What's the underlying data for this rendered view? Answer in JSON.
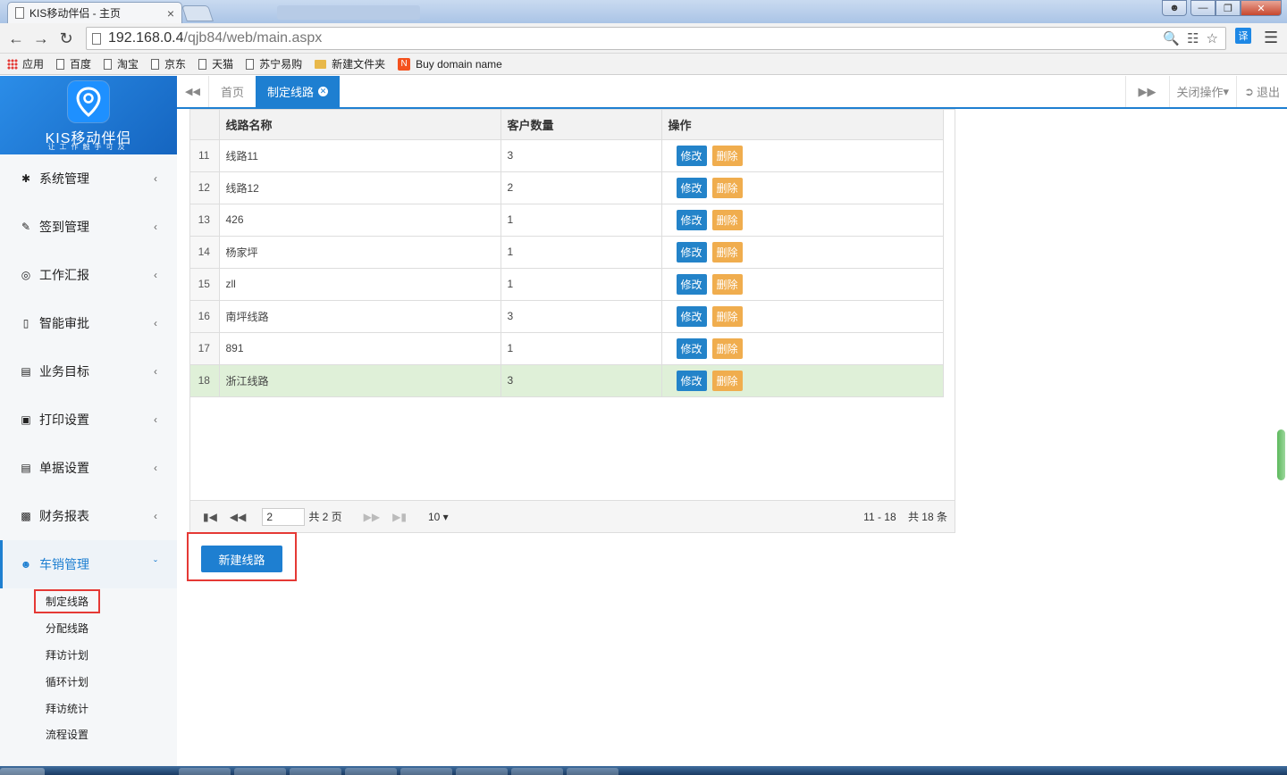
{
  "browser": {
    "tab_title": "KIS移动伴侣 - 主页",
    "tab_close": "×",
    "url_host": "192.168.0.4",
    "url_path": "/qjb84/web/main.aspx",
    "ext_label": "译",
    "bookmarks": [
      "应用",
      "百度",
      "淘宝",
      "京东",
      "天猫",
      "苏宁易购",
      "新建文件夹",
      "Buy domain name"
    ]
  },
  "brand": {
    "name": "KIS移动伴侣",
    "slogan": "让工作触手可及"
  },
  "sidebar": {
    "items": [
      {
        "label": "系统管理",
        "icon": "gear-icon"
      },
      {
        "label": "签到管理",
        "icon": "edit-icon"
      },
      {
        "label": "工作汇报",
        "icon": "target-icon"
      },
      {
        "label": "智能审批",
        "icon": "bookmark-icon"
      },
      {
        "label": "业务目标",
        "icon": "calendar-icon"
      },
      {
        "label": "打印设置",
        "icon": "monitor-icon"
      },
      {
        "label": "单据设置",
        "icon": "calendar-icon"
      },
      {
        "label": "财务报表",
        "icon": "bar-chart-icon"
      }
    ],
    "active": {
      "label": "车销管理",
      "icon": "users-icon"
    },
    "subitems": [
      "制定线路",
      "分配线路",
      "拜访计划",
      "循环计划",
      "拜访统计",
      "流程设置"
    ]
  },
  "pagetabs": {
    "home": "首页",
    "current": "制定线路",
    "close_ops": "关闭操作",
    "logout": "退出"
  },
  "grid": {
    "headers": [
      "线路名称",
      "客户数量",
      "操作"
    ],
    "edit_label": "修改",
    "delete_label": "删除",
    "rows": [
      {
        "num": "11",
        "name": "线路11",
        "count": "3"
      },
      {
        "num": "12",
        "name": "线路12",
        "count": "2"
      },
      {
        "num": "13",
        "name": "426",
        "count": "1"
      },
      {
        "num": "14",
        "name": "杨家坪",
        "count": "1"
      },
      {
        "num": "15",
        "name": "zll",
        "count": "1"
      },
      {
        "num": "16",
        "name": "南坪线路",
        "count": "3"
      },
      {
        "num": "17",
        "name": "891",
        "count": "1"
      },
      {
        "num": "18",
        "name": "浙江线路",
        "count": "3"
      }
    ],
    "selected_row": 7,
    "pager": {
      "page": "2",
      "total_pages": "共 2 页",
      "page_size": "10",
      "range": "11 - 18",
      "total": "共 18 条"
    }
  },
  "actions": {
    "new_route": "新建线路"
  },
  "colors": {
    "primary": "#1e7fd1",
    "edit": "#2383c9",
    "delete": "#f0ad4e",
    "selected_row": "#dff0d8",
    "highlight": "#e53935"
  }
}
